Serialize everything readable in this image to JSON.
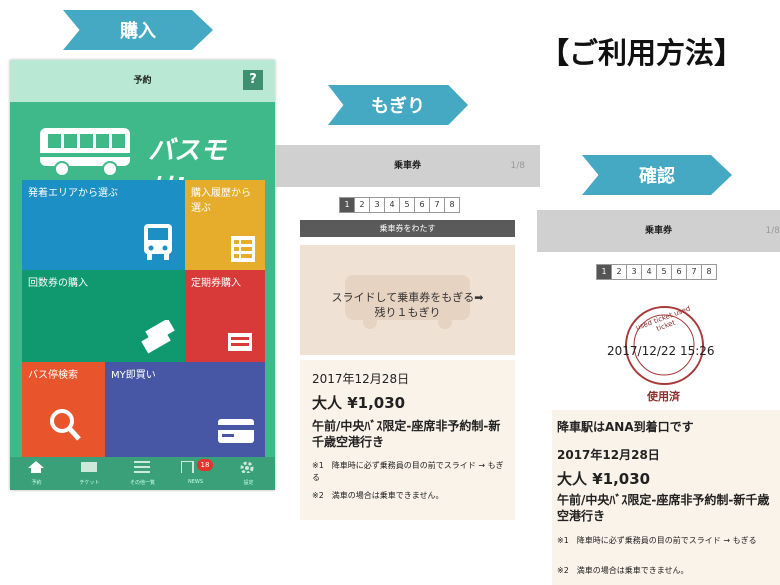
{
  "page_title": "【ご利用方法】",
  "steps": {
    "purchase": "購入",
    "tear": "もぎり",
    "confirm": "確認"
  },
  "phone1": {
    "header_title": "予約",
    "help_label": "?",
    "logo_text": "バスモリ!",
    "tiles": {
      "area": "発着エリアから選ぶ",
      "history": "購入履歴から選ぶ",
      "coupon": "回数券の購入",
      "pass": "定期券購入",
      "stop_search": "バス停検索",
      "my_purchase": "MY即買い"
    },
    "tabs": [
      {
        "label": "予約"
      },
      {
        "label": "チケット"
      },
      {
        "label": "その他一覧"
      },
      {
        "label": "NEWS",
        "badge": "18"
      },
      {
        "label": "設定"
      }
    ]
  },
  "phone2": {
    "header_title": "乗車券",
    "page_indicator": "1/8",
    "pages": [
      "1",
      "2",
      "3",
      "4",
      "5",
      "6",
      "7",
      "8"
    ],
    "handover_bar": "乗車券をわたす",
    "swipe_line1": "スライドして乗車券をもぎる➡",
    "swipe_line2": "残り１もぎり",
    "date": "2017年12月28日",
    "fare": "大人 ¥1,030",
    "route": "午前/中央ﾊﾞｽ限定-座席非予約制-新千歳空港行き",
    "note1": "※1　降車時に必ず乗務員の目の前でスライド → もぎる",
    "note2": "※2　満車の場合は乗車できません。"
  },
  "phone3": {
    "header_title": "乗車券",
    "page_indicator": "1/8",
    "pages": [
      "1",
      "2",
      "3",
      "4",
      "5",
      "6",
      "7",
      "8"
    ],
    "stamp_text": "used ticket used ticket",
    "stamp_datetime": "2017/12/22 15:26",
    "stamp_status": "使用済",
    "notice": "降車駅はANA到着口です",
    "date": "2017年12月28日",
    "fare": "大人 ¥1,030",
    "route": "午前/中央ﾊﾞｽ限定-座席非予約制-新千歳空港行き",
    "note1": "※1　降車時に必ず乗務員の目の前でスライド → もぎる",
    "note2": "※2　満車の場合は乗車できません。"
  },
  "colors": {
    "arrow": "#46a9c3",
    "app_green": "#3fb98a",
    "tile_blue": "#1c8fc4",
    "tile_yellow": "#e5ad2b",
    "tile_teal": "#10996e",
    "tile_red": "#d83a3a",
    "tile_orange": "#e8552d",
    "tile_navy": "#4857a5"
  }
}
